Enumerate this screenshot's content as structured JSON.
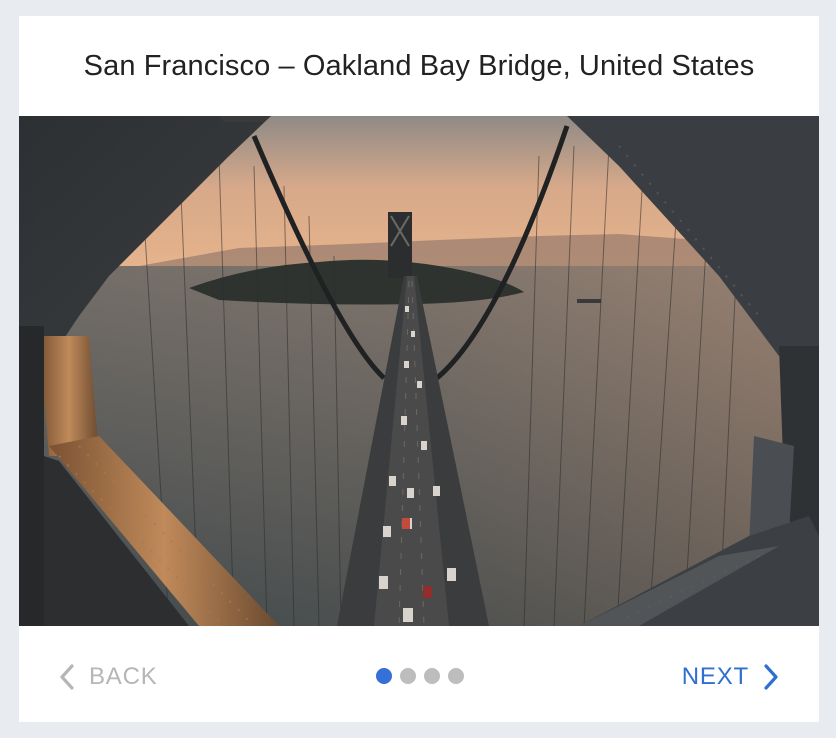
{
  "card": {
    "title": "San Francisco – Oakland Bay Bridge, United States"
  },
  "image": {
    "alt": "San Francisco – Oakland Bay Bridge, United States"
  },
  "stepper": {
    "back_label": "BACK",
    "next_label": "NEXT",
    "steps_total": 4,
    "active_step": 1
  },
  "colors": {
    "accent": "#3470d6",
    "disabled": "#b6b6b6",
    "dot_inactive": "#bdbdbd"
  },
  "icons": {
    "back": "chevron-left-icon",
    "next": "chevron-right-icon"
  }
}
